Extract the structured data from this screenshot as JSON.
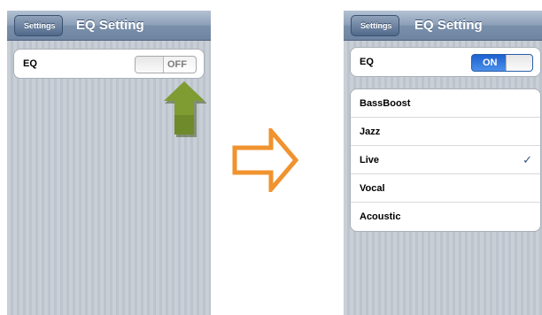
{
  "before": {
    "back_label": "Settings",
    "title": "EQ Setting",
    "eq_label": "EQ",
    "toggle_state": "OFF"
  },
  "after": {
    "back_label": "Settings",
    "title": "EQ Setting",
    "eq_label": "EQ",
    "toggle_state": "ON",
    "presets": [
      "BassBoost",
      "Jazz",
      "Live",
      "Vocal",
      "Acoustic"
    ],
    "selected_preset": "Live",
    "check_glyph": "✓"
  },
  "annotations": {
    "tap_arrow_color": "#6f8a2a",
    "transition_arrow_color": "#f0932e"
  }
}
